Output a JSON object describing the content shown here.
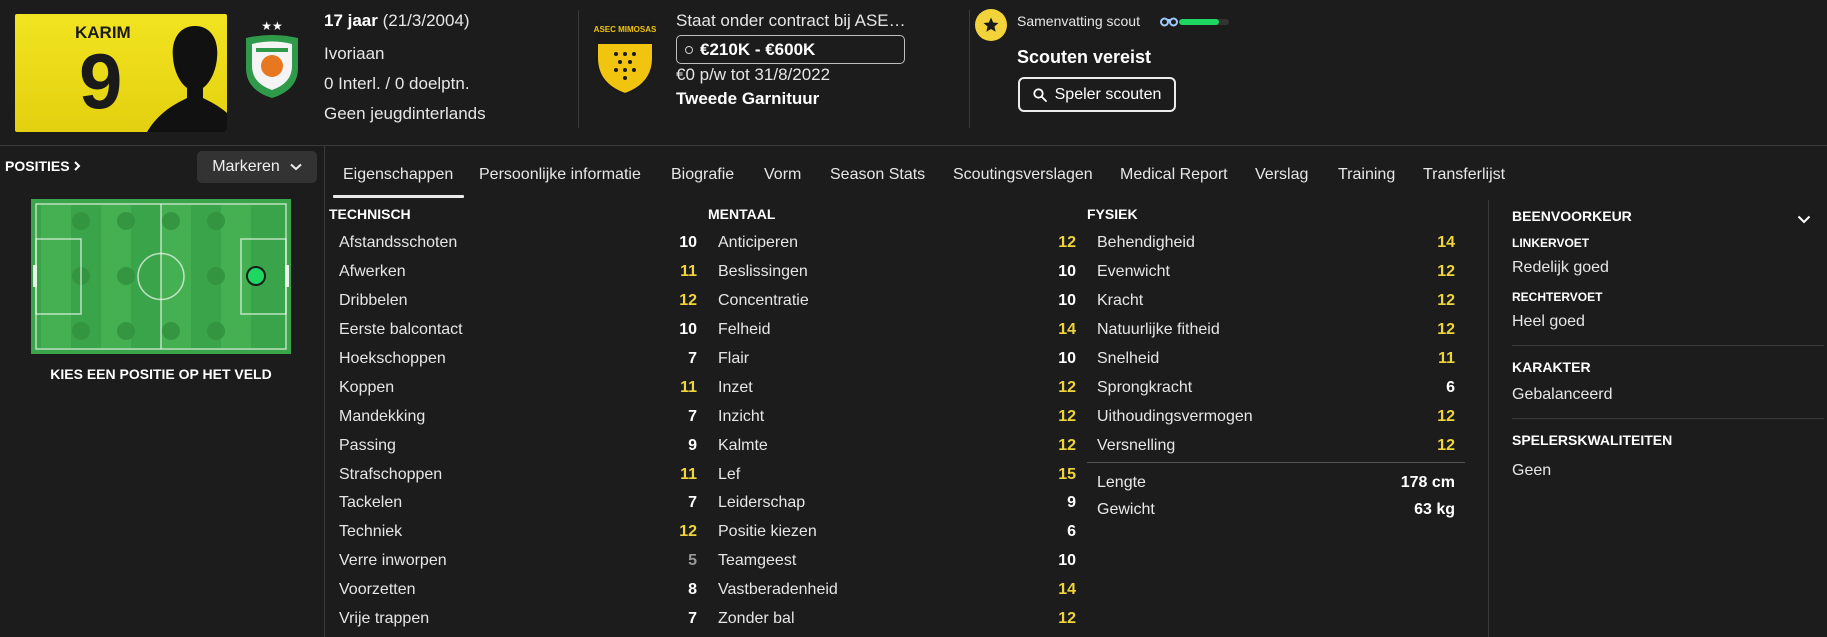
{
  "player": {
    "shirt_name": "KARIM",
    "shirt_number": "9",
    "age_line_bold": "17 jaar",
    "age_line_rest": " (21/3/2004)",
    "nationality": "Ivoriaan",
    "caps": "0 Interl. / 0 doelptn.",
    "youth_caps": "Geen jeugdinterlands"
  },
  "contract": {
    "club_line": "Staat onder contract bij ASE…",
    "value_range": "€210K - €600K",
    "wage_line": "€0 p/w tot 31/8/2022",
    "squad_status": "Tweede Garnituur",
    "club_badge_text": "ASEC MIMOSAS"
  },
  "scout": {
    "summary_label": "Samenvatting scout",
    "status": "Scouten vereist",
    "button_label": "Speler scouten",
    "knowledge_level": 0.8,
    "accent_color": "#1ed760"
  },
  "left_panel": {
    "positions_label": "POSITIES",
    "mark_button": "Markeren",
    "caption": "KIES EEN POSITIE OP HET VELD",
    "pitch_color": "#3aa44a",
    "marker_color": "#1ed760"
  },
  "tabs": [
    "Eigenschappen",
    "Persoonlijke informatie",
    "Biografie",
    "Vorm",
    "Season Stats",
    "Scoutingsverslagen",
    "Medical Report",
    "Verslag",
    "Training",
    "Transferlijst"
  ],
  "technical": {
    "title": "TECHNISCH",
    "items": [
      {
        "name": "Afstandsschoten",
        "value": "10"
      },
      {
        "name": "Afwerken",
        "value": "11"
      },
      {
        "name": "Dribbelen",
        "value": "12"
      },
      {
        "name": "Eerste balcontact",
        "value": "10"
      },
      {
        "name": "Hoekschoppen",
        "value": "7"
      },
      {
        "name": "Koppen",
        "value": "11"
      },
      {
        "name": "Mandekking",
        "value": "7"
      },
      {
        "name": "Passing",
        "value": "9"
      },
      {
        "name": "Strafschoppen",
        "value": "11"
      },
      {
        "name": "Tackelen",
        "value": "7"
      },
      {
        "name": "Techniek",
        "value": "12"
      },
      {
        "name": "Verre inworpen",
        "value": "5"
      },
      {
        "name": "Voorzetten",
        "value": "8"
      },
      {
        "name": "Vrije trappen",
        "value": "7"
      }
    ]
  },
  "mental": {
    "title": "MENTAAL",
    "items": [
      {
        "name": "Anticiperen",
        "value": "12"
      },
      {
        "name": "Beslissingen",
        "value": "10"
      },
      {
        "name": "Concentratie",
        "value": "10"
      },
      {
        "name": "Felheid",
        "value": "14"
      },
      {
        "name": "Flair",
        "value": "10"
      },
      {
        "name": "Inzet",
        "value": "12"
      },
      {
        "name": "Inzicht",
        "value": "12"
      },
      {
        "name": "Kalmte",
        "value": "12"
      },
      {
        "name": "Lef",
        "value": "15"
      },
      {
        "name": "Leiderschap",
        "value": "9"
      },
      {
        "name": "Positie kiezen",
        "value": "6"
      },
      {
        "name": "Teamgeest",
        "value": "10"
      },
      {
        "name": "Vastberadenheid",
        "value": "14"
      },
      {
        "name": "Zonder bal",
        "value": "12"
      }
    ]
  },
  "physical": {
    "title": "FYSIEK",
    "items": [
      {
        "name": "Behendigheid",
        "value": "14"
      },
      {
        "name": "Evenwicht",
        "value": "12"
      },
      {
        "name": "Kracht",
        "value": "12"
      },
      {
        "name": "Natuurlijke fitheid",
        "value": "12"
      },
      {
        "name": "Snelheid",
        "value": "11"
      },
      {
        "name": "Sprongkracht",
        "value": "6"
      },
      {
        "name": "Uithoudingsvermogen",
        "value": "12"
      },
      {
        "name": "Versnelling",
        "value": "12"
      }
    ],
    "height_label": "Lengte",
    "height_value": "178 cm",
    "weight_label": "Gewicht",
    "weight_value": "63 kg"
  },
  "right_panel": {
    "foot_title": "BEENVOORKEUR",
    "left_foot_label": "LINKERVOET",
    "left_foot_value": "Redelijk goed",
    "right_foot_label": "RECHTERVOET",
    "right_foot_value": "Heel goed",
    "character_title": "KARAKTER",
    "character_value": "Gebalanceerd",
    "qualities_title": "SPELERSKWALITEITEN",
    "qualities_value": "Geen"
  },
  "colors": {
    "attr_high": "#f0d53a",
    "attr_normal": "#ffffff",
    "attr_low": "#9a9a9a"
  }
}
